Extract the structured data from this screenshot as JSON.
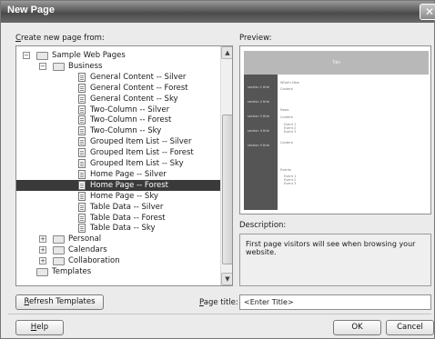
{
  "window": {
    "title": "New Page",
    "close_glyph": "✕"
  },
  "left": {
    "label_prefix": "C",
    "label_rest": "reate new page from:",
    "tree": [
      {
        "label": "Sample Web Pages",
        "level": 1,
        "type": "folder",
        "expander": "−"
      },
      {
        "label": "Business",
        "level": 2,
        "type": "folder",
        "expander": "−"
      },
      {
        "label": "General Content -- Silver",
        "level": 3,
        "type": "doc"
      },
      {
        "label": "General Content -- Forest",
        "level": 3,
        "type": "doc"
      },
      {
        "label": "General Content -- Sky",
        "level": 3,
        "type": "doc"
      },
      {
        "label": "Two-Column -- Silver",
        "level": 3,
        "type": "doc"
      },
      {
        "label": "Two-Column -- Forest",
        "level": 3,
        "type": "doc"
      },
      {
        "label": "Two-Column -- Sky",
        "level": 3,
        "type": "doc"
      },
      {
        "label": "Grouped Item List -- Silver",
        "level": 3,
        "type": "doc"
      },
      {
        "label": "Grouped Item List -- Forest",
        "level": 3,
        "type": "doc"
      },
      {
        "label": "Grouped Item List -- Sky",
        "level": 3,
        "type": "doc"
      },
      {
        "label": "Home Page -- Silver",
        "level": 3,
        "type": "doc"
      },
      {
        "label": "Home Page -- Forest",
        "level": 3,
        "type": "doc",
        "selected": true
      },
      {
        "label": "Home Page -- Sky",
        "level": 3,
        "type": "doc"
      },
      {
        "label": "Table Data -- Silver",
        "level": 3,
        "type": "doc"
      },
      {
        "label": "Table Data -- Forest",
        "level": 3,
        "type": "doc"
      },
      {
        "label": "Table Data -- Sky",
        "level": 3,
        "type": "doc"
      },
      {
        "label": "Personal",
        "level": 2,
        "type": "folder",
        "expander": "+"
      },
      {
        "label": "Calendars",
        "level": 2,
        "type": "folder",
        "expander": "+"
      },
      {
        "label": "Collaboration",
        "level": 2,
        "type": "folder",
        "expander": "+"
      },
      {
        "label": "Templates",
        "level": 1,
        "type": "folder"
      }
    ],
    "scroll_up": "▲",
    "scroll_down": "▼"
  },
  "preview": {
    "label": "Preview:",
    "thumb_title": "Title",
    "thumb_sections": [
      "section 1 title",
      "section 2 title",
      "section 3 title",
      "section 4 title",
      "section 5 title"
    ],
    "thumb_main": [
      "What's New",
      "Content",
      "News",
      "Content",
      "Event 1",
      "Event 2",
      "Event 3",
      "Content",
      "Events",
      "Event 1",
      "Event 2",
      "Event 3"
    ]
  },
  "description": {
    "label": "Description:",
    "text": "First page visitors will see when browsing your website."
  },
  "buttons": {
    "refresh_prefix": "R",
    "refresh_rest": "efresh Templates",
    "help_prefix": "H",
    "help_rest": "elp",
    "ok": "OK",
    "cancel": "Cancel"
  },
  "page_title": {
    "label_prefix": "P",
    "label_rest": "age title:",
    "value": "<Enter Title>"
  }
}
